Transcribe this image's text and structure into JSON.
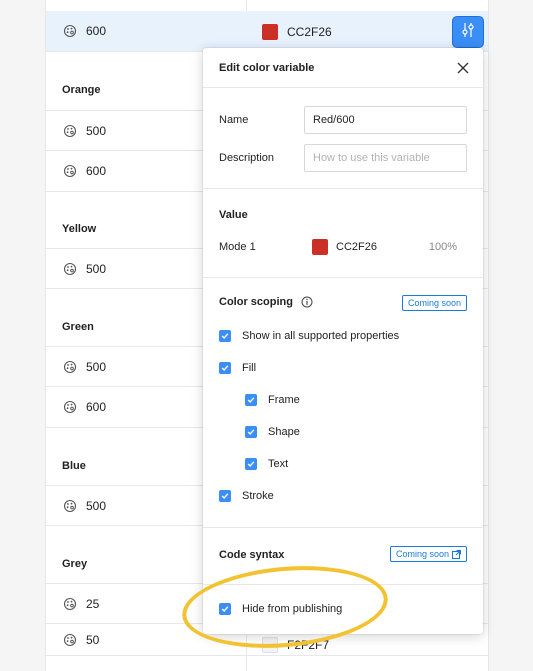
{
  "table": {
    "rows": [
      {
        "name": "600",
        "value": "CC2F26",
        "color": "#CC2F26",
        "selected": true
      },
      {
        "group": "Orange"
      },
      {
        "name": "500"
      },
      {
        "name": "600"
      },
      {
        "group": "Yellow"
      },
      {
        "name": "500"
      },
      {
        "group": "Green"
      },
      {
        "name": "500"
      },
      {
        "name": "600"
      },
      {
        "group": "Blue"
      },
      {
        "name": "500"
      },
      {
        "group": "Grey"
      },
      {
        "name": "25"
      },
      {
        "name": "50",
        "value": "F2F2F7",
        "color": "#F2F2F7"
      }
    ]
  },
  "modal": {
    "title": "Edit color variable",
    "name_label": "Name",
    "name_value": "Red/600",
    "description_label": "Description",
    "description_placeholder": "How to use this variable",
    "value_title": "Value",
    "mode_label": "Mode 1",
    "mode_value": "CC2F26",
    "mode_color": "#CC2F26",
    "mode_opacity": "100%",
    "scoping_title": "Color scoping",
    "coming_soon_1": "Coming soon",
    "scopes": [
      {
        "label": "Show in all supported properties",
        "checked": true,
        "indent": false
      },
      {
        "label": "Fill",
        "checked": true,
        "indent": false
      },
      {
        "label": "Frame",
        "checked": true,
        "indent": true
      },
      {
        "label": "Shape",
        "checked": true,
        "indent": true
      },
      {
        "label": "Text",
        "checked": true,
        "indent": true
      },
      {
        "label": "Stroke",
        "checked": true,
        "indent": false
      }
    ],
    "code_syntax_title": "Code syntax",
    "coming_soon_2": "Coming soon",
    "hide_label": "Hide from publishing"
  },
  "colors": {
    "accent": "#3A8EF6",
    "highlight": "#F2C230"
  }
}
